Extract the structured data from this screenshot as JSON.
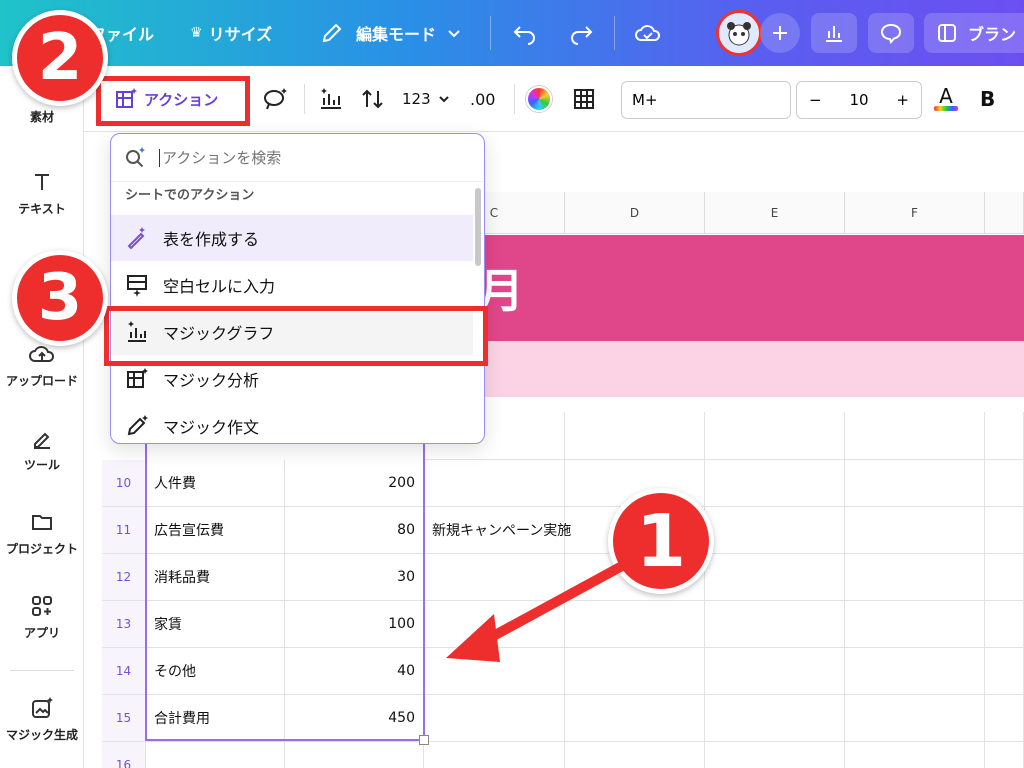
{
  "topbar": {
    "file_label": "ファイル",
    "resize_label": "リサイズ",
    "edit_mode_label": "編集モード",
    "brand_label": "ブラン"
  },
  "sidebar": {
    "items": [
      {
        "label": "素材"
      },
      {
        "label": "テキスト"
      },
      {
        "label": "アップロード"
      },
      {
        "label": "ツール"
      },
      {
        "label": "プロジェクト"
      },
      {
        "label": "アプリ"
      },
      {
        "label": "マジック生成"
      }
    ]
  },
  "toolbar": {
    "action_label": "アクション",
    "number_format_label": "123",
    "decimal_label": ".00",
    "font_name": "M+",
    "font_size": "10",
    "minus_label": "−",
    "plus_label": "+",
    "bold_label": "B"
  },
  "dropdown": {
    "search_placeholder": "アクションを検索",
    "section_title": "シートでのアクション",
    "items": [
      {
        "label": "表を作成する"
      },
      {
        "label": "空白セルに入力"
      },
      {
        "label": "マジックグラフ"
      },
      {
        "label": "マジック分析"
      },
      {
        "label": "マジック作文"
      }
    ]
  },
  "grid": {
    "columns": [
      "C",
      "D",
      "E",
      "F"
    ],
    "banner_text": "月",
    "rows": [
      {
        "num": "10",
        "item": "人件費",
        "value": "200",
        "note": ""
      },
      {
        "num": "11",
        "item": "広告宣伝費",
        "value": "80",
        "note": "新規キャンペーン実施"
      },
      {
        "num": "12",
        "item": "消耗品費",
        "value": "30",
        "note": ""
      },
      {
        "num": "13",
        "item": "家賃",
        "value": "100",
        "note": ""
      },
      {
        "num": "14",
        "item": "その他",
        "value": "40",
        "note": ""
      },
      {
        "num": "15",
        "item": "合計費用",
        "value": "450",
        "note": ""
      },
      {
        "num": "16",
        "item": "",
        "value": "",
        "note": ""
      }
    ]
  },
  "callouts": {
    "one": "1",
    "two": "2",
    "three": "3"
  },
  "colors": {
    "accent": "#7a4fd6",
    "banner": "#e0468a",
    "banner_light": "#fbd3e5",
    "callout": "#ee2d2d"
  }
}
